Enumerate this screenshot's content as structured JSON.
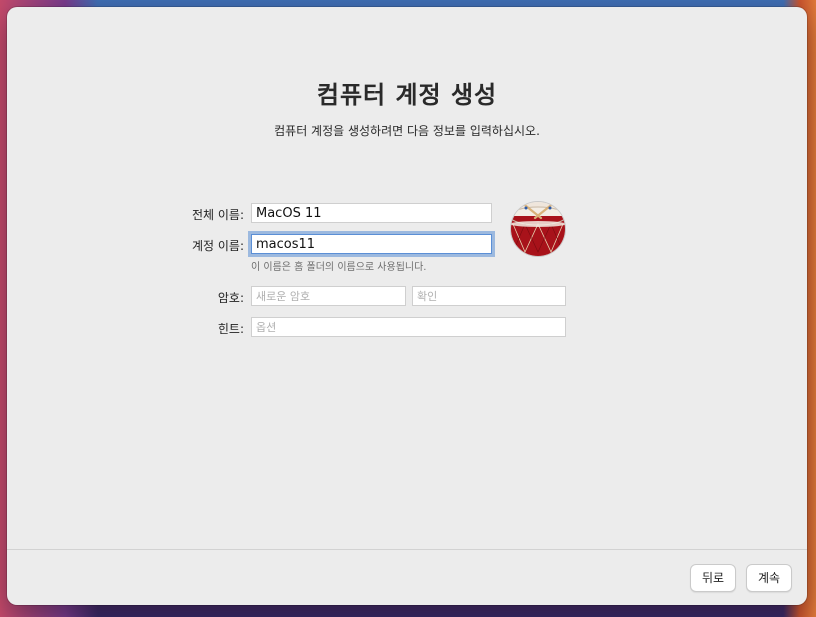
{
  "window": {
    "title": "컴퓨터 계정 생성",
    "subtitle": "컴퓨터 계정을 생성하려면 다음 정보를 입력하십시오."
  },
  "form": {
    "full_name_label": "전체 이름:",
    "full_name_value": "MacOS 11",
    "account_name_label": "계정 이름:",
    "account_name_value": "macos11",
    "account_name_hint": "이 이름은 홈 폴더의 이름으로 사용됩니다.",
    "password_label": "암호:",
    "password_placeholder": "새로운 암호",
    "verify_placeholder": "확인",
    "hint_label": "힌트:",
    "hint_placeholder": "옵션"
  },
  "avatar": {
    "icon": "drum-icon",
    "colors": {
      "drum_red": "#a8121a",
      "drum_rim": "#f3ede4",
      "sticks": "#d9b27a"
    }
  },
  "buttons": {
    "back_label": "뒤로",
    "continue_label": "계속"
  }
}
